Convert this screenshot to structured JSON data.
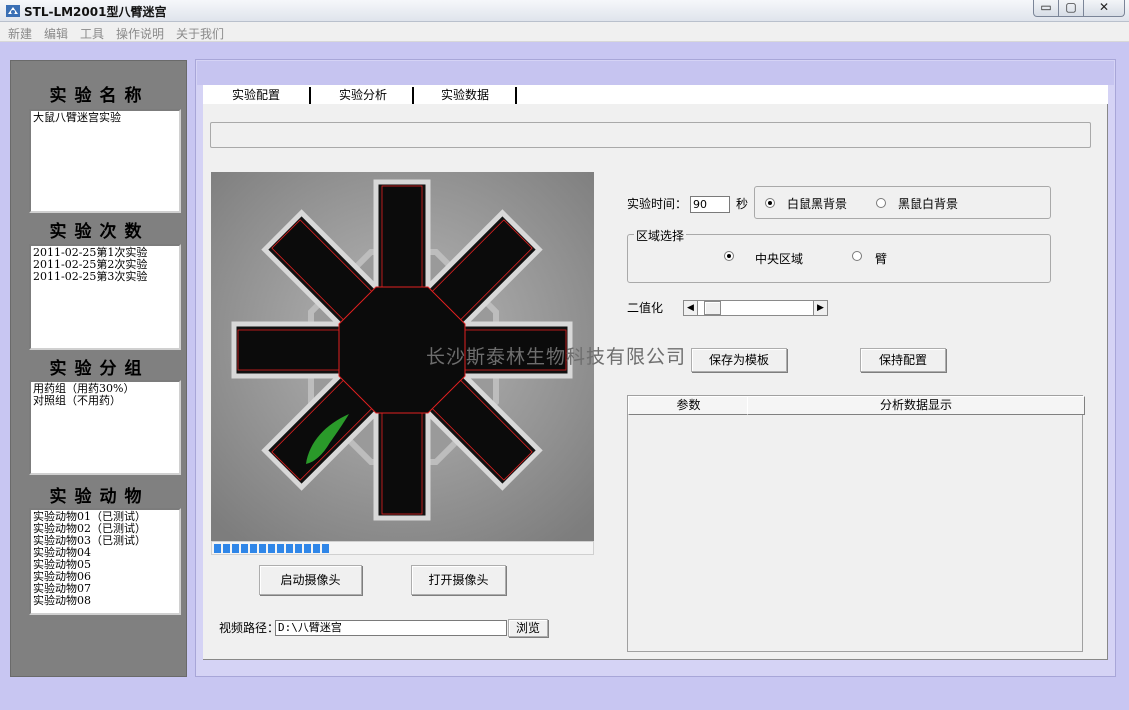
{
  "window": {
    "title": "STL-LM2001型八臂迷宫",
    "min": "▭",
    "max": "▢",
    "close": "✕"
  },
  "menu": [
    "新建",
    "编辑",
    "工具",
    "操作说明",
    "关于我们"
  ],
  "left": {
    "sections": [
      {
        "title": "实验名称",
        "items": [
          "大鼠八臂迷宫实验"
        ]
      },
      {
        "title": "实验次数",
        "items": [
          "2011-02-25第1次实验",
          "2011-02-25第2次实验",
          "2011-02-25第3次实验"
        ]
      },
      {
        "title": "实验分组",
        "items": [
          "用药组（用药30%）",
          "对照组（不用药）"
        ]
      },
      {
        "title": "实验动物",
        "items": [
          "实验动物01（已测试）",
          "实验动物02（已测试）",
          "实验动物03（已测试）",
          "实验动物04",
          "实验动物05",
          "实验动物06",
          "实验动物07",
          "实验动物08"
        ]
      }
    ]
  },
  "tabs": [
    {
      "label": "实验配置"
    },
    {
      "label": "实验分析"
    },
    {
      "label": "实验数据"
    }
  ],
  "progress": {
    "filled_fraction": 0.3
  },
  "buttons": {
    "start_camera": "启动摄像头",
    "open_camera": "打开摄像头",
    "browse": "浏览",
    "save_template": "保存为模板",
    "keep_config": "保持配置"
  },
  "video_path": {
    "label": "视频路径：",
    "value": "D:\\八臂迷宫"
  },
  "config": {
    "time_label": "实验时间：",
    "time_value": "90",
    "time_unit": "秒",
    "bg_options": [
      {
        "label": "白鼠黑背景",
        "selected": true
      },
      {
        "label": "黑鼠白背景",
        "selected": false
      }
    ],
    "region_title": "区域选择",
    "region_options": [
      {
        "label": "中央区域",
        "selected": true
      },
      {
        "label": "臂",
        "selected": false
      }
    ],
    "binarize_label": "二值化",
    "binarize_level": 0.06
  },
  "table": {
    "headers": [
      "参数",
      "分析数据显示"
    ]
  },
  "watermark": "长沙斯泰林生物科技有限公司",
  "colors": {
    "frame": "#c8c6f2",
    "left_panel": "#808080",
    "progress": "#2f86e8",
    "maze_outline": "#e02020"
  }
}
